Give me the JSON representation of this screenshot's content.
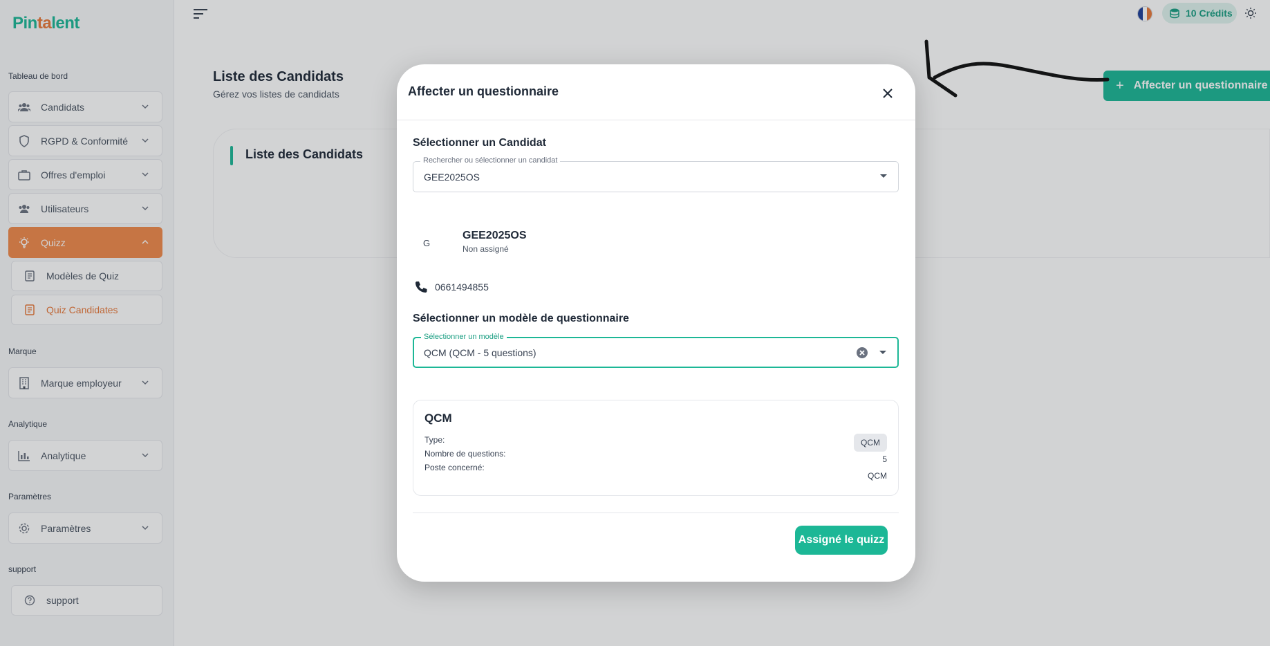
{
  "brand": {
    "name_part1": "Pin",
    "name_part2": "ta",
    "name_part3": "lent",
    "color": "#1cb796",
    "accent": "#e8783a"
  },
  "sidebar": {
    "sections": {
      "dashboard": "Tableau de bord",
      "brand": "Marque",
      "analytics": "Analytique",
      "settings": "Paramètres",
      "support": "support"
    },
    "items": {
      "candidates": "Candidats",
      "gdpr": "RGPD & Conformité",
      "jobs": "Offres d'emploi",
      "users": "Utilisateurs",
      "quiz": "Quizz",
      "quiz_models": "Modèles de Quiz",
      "quiz_candidates": "Quiz Candidates",
      "employer_brand": "Marque employeur",
      "analytics": "Analytique",
      "settings": "Paramètres",
      "support": "support"
    },
    "active_color": "#f08a4b"
  },
  "topbar": {
    "credits": "10 Crédits"
  },
  "page": {
    "title": "Liste des Candidats",
    "subtitle": "Gérez vos listes de candidats",
    "card_title": "Liste des Candidats",
    "add_button": "Affecter un questionnaire"
  },
  "modal": {
    "title": "Affecter un questionnaire",
    "candidate_heading": "Sélectionner un Candidat",
    "candidate_field_label": "Rechercher ou sélectionner un candidat",
    "candidate_field_value": "GEE2025OS",
    "candidate": {
      "initial": "G",
      "name": "GEE2025OS",
      "status": "Non assigné",
      "phone": "0661494855"
    },
    "model_heading": "Sélectionner un modèle de questionnaire",
    "model_field_label": "Sélectionner un modèle",
    "model_field_value": "QCM (QCM - 5 questions)",
    "quiz_card": {
      "title": "QCM",
      "type_label": "Type:",
      "type_value": "QCM",
      "count_label": "Nombre de questions:",
      "count_value": "5",
      "position_label": "Poste concerné:",
      "position_value": "QCM"
    },
    "submit": "Assigné le quizz"
  }
}
